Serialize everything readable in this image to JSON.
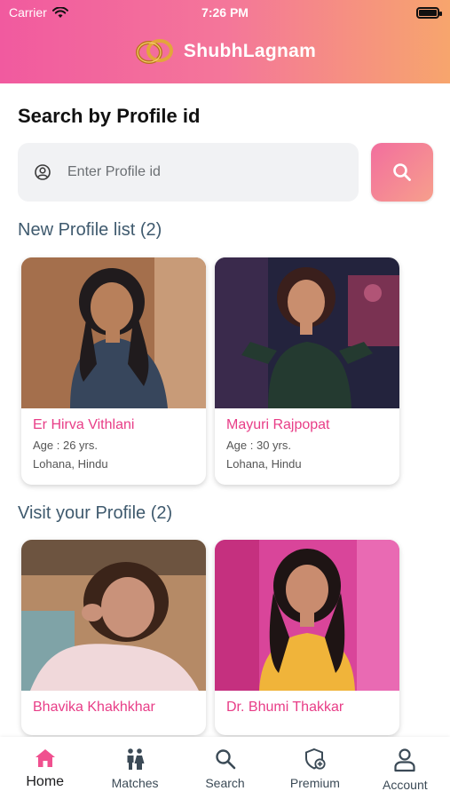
{
  "status_bar": {
    "carrier": "Carrier",
    "time": "7:26 PM"
  },
  "app": {
    "name": "ShubhLagnam"
  },
  "search": {
    "title": "Search by Profile id",
    "placeholder": "Enter Profile id",
    "value": ""
  },
  "new_profiles": {
    "title": "New Profile list (2)",
    "items": [
      {
        "name": "Er Hirva Vithlani",
        "age": "Age : 26 yrs.",
        "community": "Lohana, Hindu"
      },
      {
        "name": "Mayuri Rajpopat",
        "age": "Age : 30 yrs.",
        "community": "Lohana, Hindu"
      }
    ]
  },
  "visit_profiles": {
    "title": "Visit your Profile (2)",
    "items": [
      {
        "name": "Bhavika Khakhkhar"
      },
      {
        "name": "Dr. Bhumi Thakkar"
      }
    ]
  },
  "bottom_nav": [
    {
      "label": "Home",
      "icon": "home-icon",
      "active": true
    },
    {
      "label": "Matches",
      "icon": "couple-icon",
      "active": false
    },
    {
      "label": "Search",
      "icon": "search-icon",
      "active": false
    },
    {
      "label": "Premium",
      "icon": "premium-shield-icon",
      "active": false
    },
    {
      "label": "Account",
      "icon": "user-icon",
      "active": false
    }
  ],
  "colors": {
    "accent_pink": "#e83d87",
    "gradient_start": "#f15a9f",
    "gradient_end": "#f7a56d",
    "subtitle": "#3f5a6e",
    "nav_active": "#f0508f"
  }
}
